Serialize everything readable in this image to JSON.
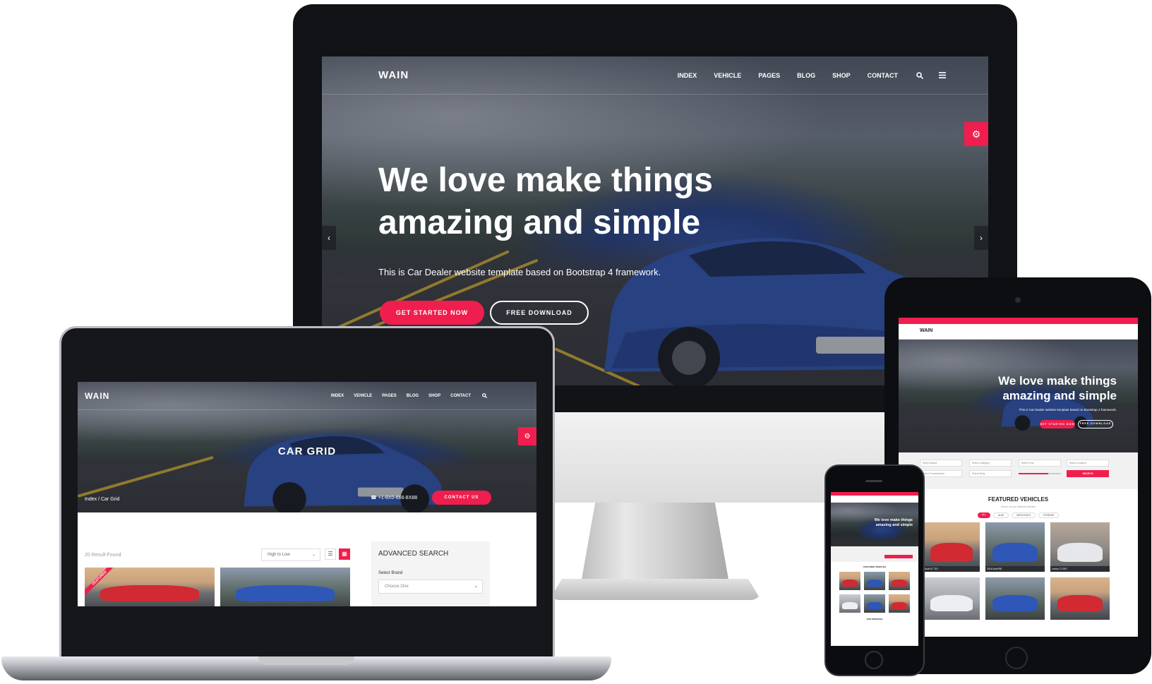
{
  "colors": {
    "accent": "#f01e4e",
    "dark": "#15171b",
    "road_line": "#d8b332",
    "car_blue": "#2f57b8"
  },
  "desktop": {
    "brand": "WAIN",
    "nav": [
      "INDEX",
      "VEHICLE",
      "PAGES",
      "BLOG",
      "SHOP",
      "CONTACT"
    ],
    "hero_title_line1": "We love make things",
    "hero_title_line2": "amazing and simple",
    "hero_subtitle": "This is Car Dealer website template based on Bootstrap 4 framework.",
    "btn_primary": "GET STARTED NOW",
    "btn_secondary": "FREE DOWNLOAD",
    "icons": {
      "search": "search-icon",
      "menu": "menu-icon",
      "gear": "gear-icon",
      "prev": "chevron-left-icon",
      "next": "chevron-right-icon"
    }
  },
  "laptop": {
    "brand": "WAIN",
    "nav": [
      "INDEX",
      "VEHICLE",
      "PAGES",
      "BLOG",
      "SHOP",
      "CONTACT"
    ],
    "page_title": "CAR GRID",
    "breadcrumb_home": "Index",
    "breadcrumb_current": "Car Grid",
    "phone": "+1-8X0-666-8X88",
    "contact_btn": "CONTACT US",
    "results": "20 Result Found",
    "sort_value": "High to Low",
    "search_title": "ADVANCED SEARCH",
    "select_brand_label": "Select Brand",
    "select_brand_value": "Choose One",
    "featured_ribbon": "FEATURED"
  },
  "tablet": {
    "brand": "WAIN",
    "hero_title_line1": "We love make things",
    "hero_title_line2": "amazing and simple",
    "hero_subtitle": "This is Car Dealer website template based on Bootstrap 4 framework.",
    "btn_primary": "GET STARTED NOW",
    "btn_secondary": "FREE DOWNLOAD",
    "filters": [
      "Select Brand",
      "Select Category",
      "Select Year",
      "Select Location",
      "Select Transmission",
      "Select Body"
    ],
    "search_btn": "SEARCH",
    "featured_title": "FEATURED VEHICLES",
    "featured_sub": "Check out our featured vehicles",
    "filter_tabs": [
      "ALL",
      "AUDI",
      "MERCEDES",
      "FERRARI"
    ],
    "car_names": [
      "Audi A7 TDI",
      "2016 Audi R8",
      "Lexus CI 2017"
    ]
  },
  "phone": {
    "hero_title_line1": "We love make things",
    "hero_title_line2": "amazing and simple",
    "featured_title": "FEATURED VEHICLES",
    "services_title": "OUR SERVICES"
  }
}
